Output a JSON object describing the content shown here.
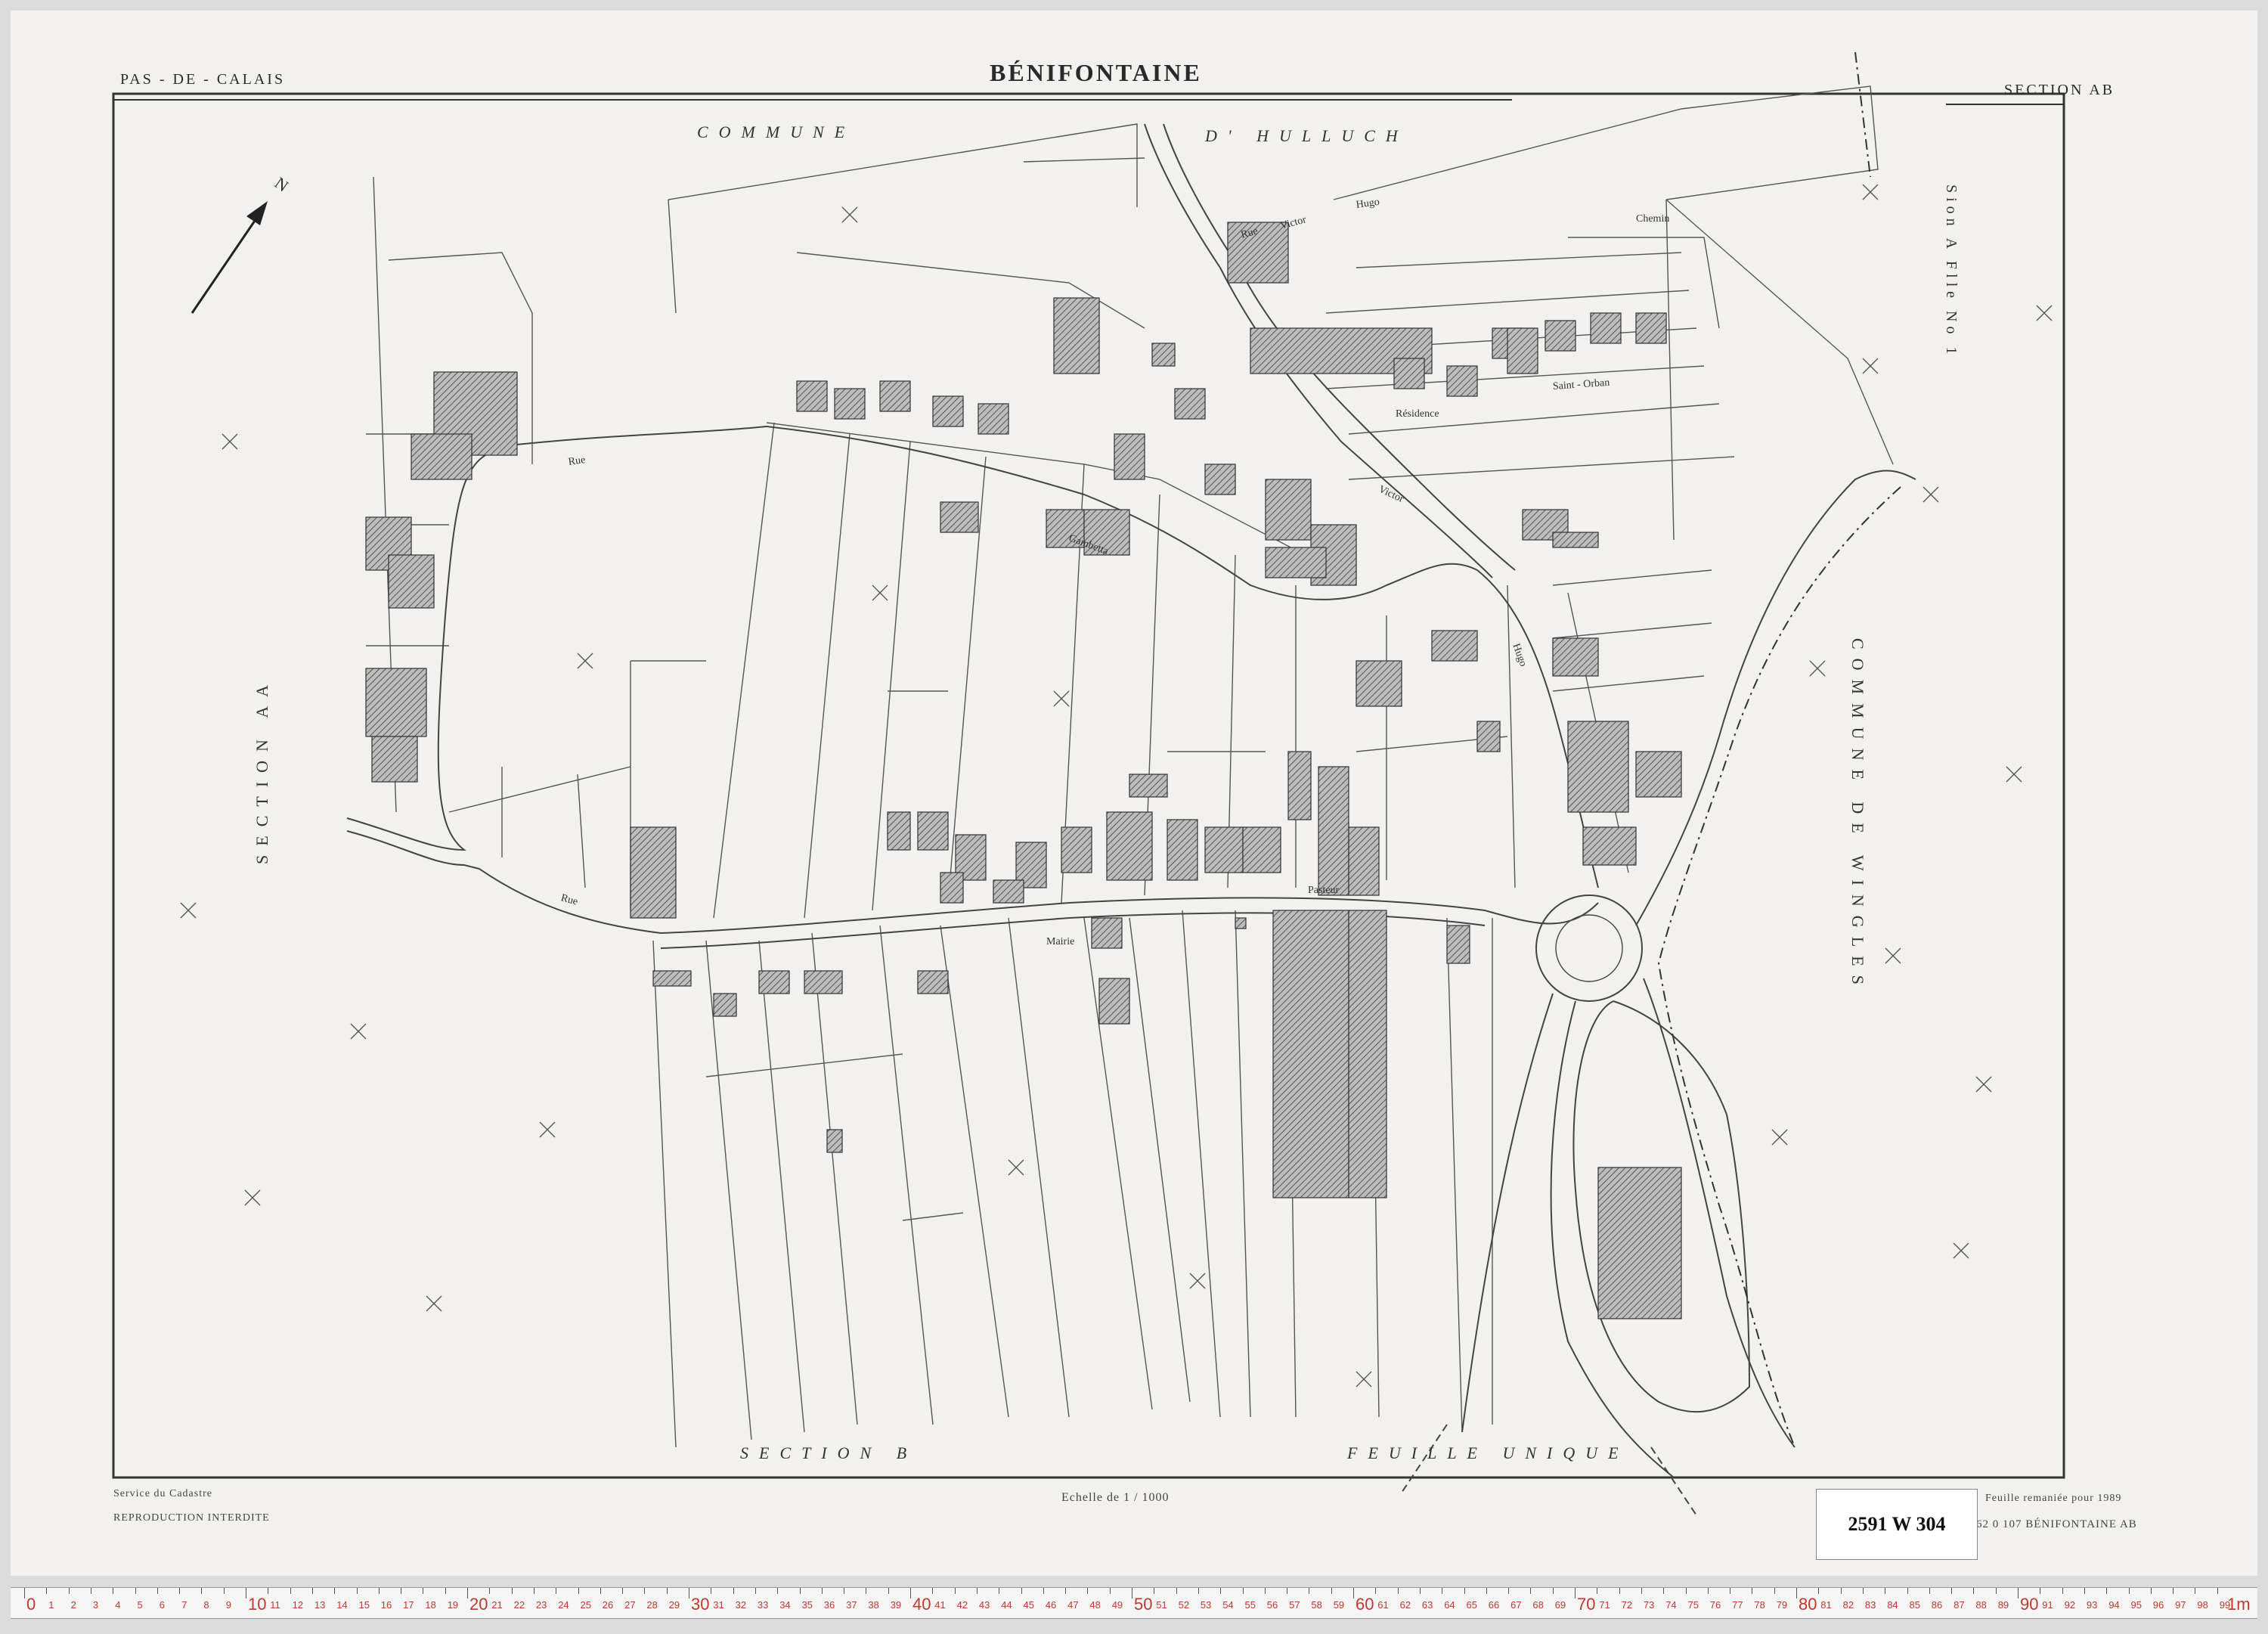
{
  "header": {
    "department": "PAS - DE - CALAIS",
    "commune": "BÉNIFONTAINE",
    "section": "SECTION  AB"
  },
  "neighbours": {
    "north_left": "COMMUNE",
    "north_right": "D' HULLUCH",
    "west": "SECTION   AA",
    "east": "COMMUNE   DE   WINGLES",
    "east_side_sheet": "Sion A  Flle No 1",
    "south_section": "SECTION   B",
    "south_sheet": "FEUILLE   UNIQUE"
  },
  "streets": {
    "rue_victor_hugo_1": "Rue",
    "rue_victor_hugo_2": "Victor",
    "rue_victor_hugo_3": "Hugo",
    "rue_pasteur": "Pasteur",
    "rue_gambetta": "Gambetta",
    "residence": "Résidence",
    "saint_orban": "Saint - Orban",
    "chemin": "Chemin",
    "mairie": "Mairie"
  },
  "footer": {
    "service": "Service du Cadastre",
    "reproduction": "REPRODUCTION  INTERDITE",
    "scale": "Echelle de  1 / 1000",
    "remaniee": "Feuille remaniée pour 1989",
    "reference": "62 0 107  BÉNIFONTAINE  AB"
  },
  "stamp": {
    "cote": "2591 W 304"
  },
  "colors": {
    "paper": "#f2f1ee",
    "ink": "#3a3a3a",
    "hatch": "#555555",
    "ruler_text": "#c0392b"
  },
  "ruler": {
    "unit_label": "1m"
  },
  "icons": {
    "north_arrow": "north-arrow-icon",
    "north_letter": "N"
  }
}
